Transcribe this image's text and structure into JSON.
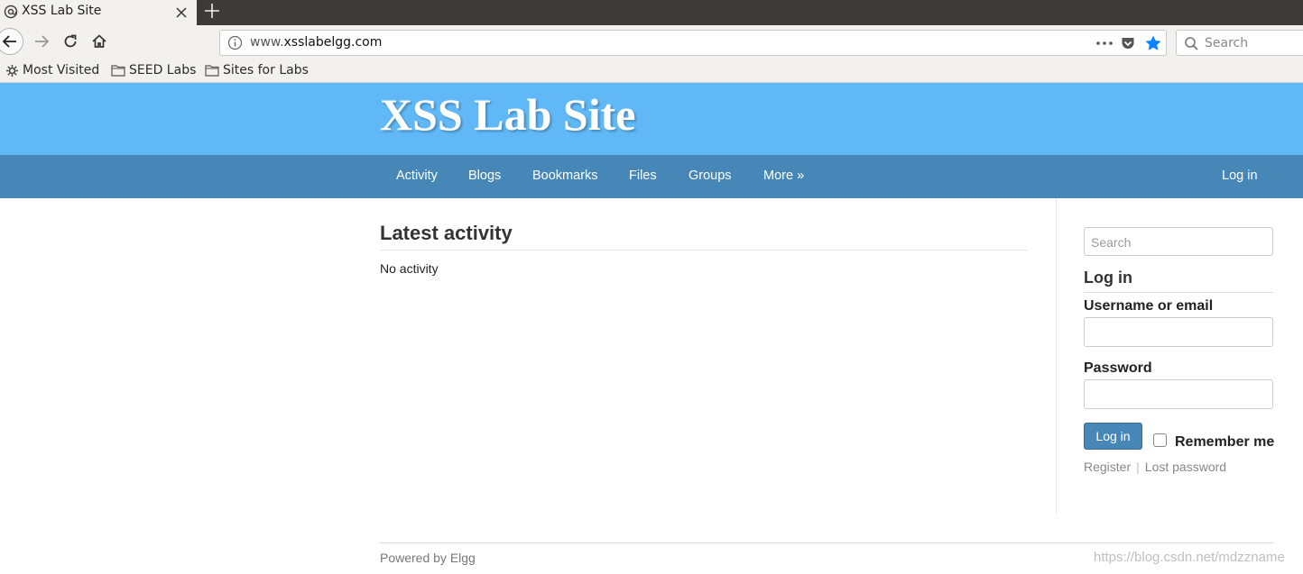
{
  "browser": {
    "tab_title": "XSS Lab Site",
    "url_prefix": "www.",
    "url_domain": "xsslabelgg.com",
    "search_placeholder": "Search",
    "bookmarks": [
      "Most Visited",
      "SEED Labs",
      "Sites for Labs"
    ]
  },
  "site": {
    "title": "XSS Lab Site",
    "nav": {
      "activity": "Activity",
      "blogs": "Blogs",
      "bookmarks": "Bookmarks",
      "files": "Files",
      "groups": "Groups",
      "more": "More",
      "more_glyph": "»",
      "login": "Log in"
    },
    "main": {
      "title": "Latest activity",
      "empty": "No activity"
    },
    "sidebar": {
      "search_placeholder": "Search",
      "login_heading": "Log in",
      "username_label": "Username or email",
      "password_label": "Password",
      "login_button": "Log in",
      "remember_label": "Remember me",
      "register_link": "Register",
      "separator": "|",
      "lost_password_link": "Lost password"
    },
    "footer": "Powered by Elgg"
  },
  "watermark": "https://blog.csdn.net/mdzzname",
  "colors": {
    "header": "#60b8f7",
    "nav": "#4787b8",
    "star": "#0a84ff"
  }
}
